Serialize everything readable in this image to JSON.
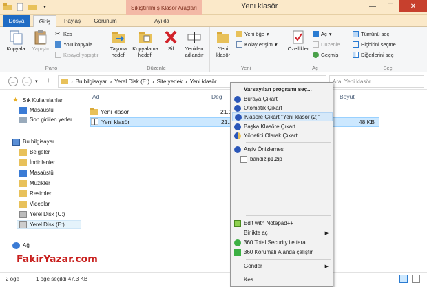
{
  "window": {
    "title": "Yeni klasör",
    "context_tab_header": "Sıkıştırılmış Klasör Araçları"
  },
  "tabs": {
    "dosya": "Dosya",
    "giris": "Giriş",
    "paylas": "Paylaş",
    "gorunum": "Görünüm",
    "ayikla": "Ayıkla"
  },
  "ribbon": {
    "pano": {
      "label": "Pano",
      "kopyala": "Kopyala",
      "yapistir": "Yapıştır",
      "kes": "Kes",
      "yolu_kopyala": "Yolu kopyala",
      "kisayol": "Kısayol yapıştır"
    },
    "duzenle": {
      "label": "Düzenle",
      "tasima": "Taşıma hedefi",
      "kopyalama": "Kopyalama hedefi",
      "sil": "Sil",
      "yeniden": "Yeniden adlandır"
    },
    "yeni": {
      "label": "Yeni",
      "klasor": "Yeni klasör",
      "oge": "Yeni öğe",
      "kolay": "Kolay erişim"
    },
    "ac": {
      "label": "Aç",
      "ozellikler": "Özellikler",
      "ac": "Aç",
      "duzenle": "Düzenle",
      "gecmis": "Geçmiş"
    },
    "sec": {
      "label": "Seç",
      "tumunu": "Tümünü seç",
      "hicbirini": "Hiçbirini seçme",
      "digerlerini": "Diğerlerini seç"
    }
  },
  "address": {
    "path": [
      "Bu bilgisayar",
      "Yerel Disk (E:)",
      "Site yedek",
      "Yeni klasör"
    ],
    "search_placeholder": "Ara: Yeni klasör"
  },
  "nav": {
    "sik": "Sık Kullanılanlar",
    "items": [
      "Masaüstü",
      "Son gidilen yerler"
    ],
    "bu_bilgisayar": "Bu bilgisayar",
    "pc_items": [
      "Belgeler",
      "İndirilenler",
      "Masaüstü",
      "Müzikler",
      "Resimler",
      "Videolar",
      "Yerel Disk (C:)",
      "Yerel Disk (E:)"
    ],
    "ag": "Ağ"
  },
  "columns": {
    "ad": "Ad",
    "degistirme": "Değ",
    "boyut": "Boyut"
  },
  "files": [
    {
      "name": "Yeni klasör",
      "date": "21.1",
      "size": ""
    },
    {
      "name": "Yeni klasör",
      "date": "21.1",
      "size": "48 KB"
    }
  ],
  "status": {
    "count": "2 öğe",
    "selected": "1 öğe seçildi  47,3 KB"
  },
  "context_menu": {
    "items": [
      "Varsayılan programı seç...",
      "Buraya Çıkart",
      "Otomatik Çıkart",
      "Klasöre Çıkart \"Yeni klasör (2)\"",
      "Başka Klasöre Çıkart",
      "Yönetici Olarak Çıkart",
      "Arşiv Önizlemesi",
      "bandizip1.zip",
      "Edit with Notepad++",
      "Birlikte aç",
      "360 Total Security ile tara",
      "360 Korumalı Alanda çalıştır",
      "Gönder",
      "Kes"
    ]
  },
  "watermark": "FakirYazar.com",
  "colors": {
    "accent": "#1f6bc4",
    "highlight": "#d5e8f9",
    "folder": "#e8c15a"
  }
}
